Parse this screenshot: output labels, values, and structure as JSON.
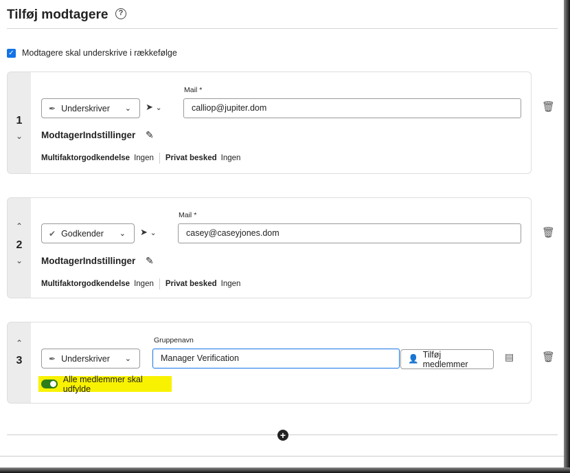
{
  "header": {
    "title": "Tilføj modtagere",
    "help_icon": "help-circle-icon"
  },
  "sequential": {
    "label": "Modtagere skal underskrive i rækkefølge",
    "checked": true
  },
  "recipients": [
    {
      "number": "1",
      "role": "Underskriver",
      "field_label": "Mail",
      "required_mark": "*",
      "value": "calliop@jupiter.dom",
      "settings_label": "ModtagerIndstillinger",
      "mfa_label": "Multifaktorgodkendelse",
      "mfa_value": "Ingen",
      "private_label": "Privat besked",
      "private_value": "Ingen"
    },
    {
      "number": "2",
      "role": "Godkender",
      "field_label": "Mail",
      "required_mark": "*",
      "value": "casey@caseyjones.dom",
      "settings_label": "ModtagerIndstillinger",
      "mfa_label": "Multifaktorgodkendelse",
      "mfa_value": "Ingen",
      "private_label": "Privat besked",
      "private_value": "Ingen"
    },
    {
      "number": "3",
      "role": "Underskriver",
      "field_label": "Gruppenavn",
      "value": "Manager Verification",
      "add_members_label": "Tilføj medlemmer",
      "toggle_label": "Alle medlemmer skal udfylde",
      "toggle_on": true,
      "highlight_color": "#f8f200"
    }
  ],
  "colors": {
    "accent": "#1473e6",
    "toggle": "#2d7d1a"
  }
}
